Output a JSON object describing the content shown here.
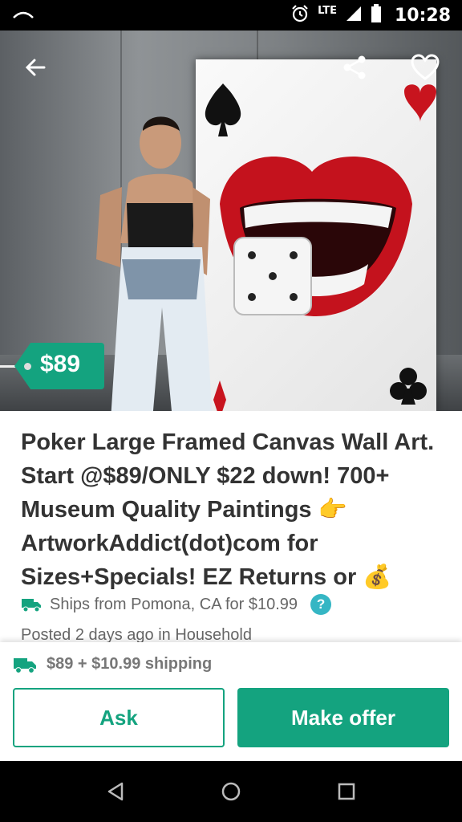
{
  "status_bar": {
    "network": "LTE",
    "time": "10:28",
    "icons": [
      "notification-icon",
      "alarm-icon",
      "signal-icon",
      "battery-icon"
    ]
  },
  "toolbar": {
    "back_icon": "back-arrow-icon",
    "share_icon": "share-icon",
    "favorite_icon": "heart-icon"
  },
  "listing": {
    "price_tag": "$89",
    "title": "Poker Large Framed Canvas Wall Art. Start @$89/ONLY $22 down! 700+ Museum Quality Paintings 👉 ArtworkAddict(dot)com for Sizes+Specials! EZ Returns or 💰",
    "ships_from": "Ships from Pomona, CA for $10.99",
    "help_label": "?",
    "posted": "Posted 2 days ago in Household"
  },
  "bottom": {
    "shipping_summary": "$89 + $10.99 shipping",
    "ask_label": "Ask",
    "offer_label": "Make offer"
  },
  "colors": {
    "brand_green": "#14a37f",
    "help_blue": "#35b6c4"
  }
}
